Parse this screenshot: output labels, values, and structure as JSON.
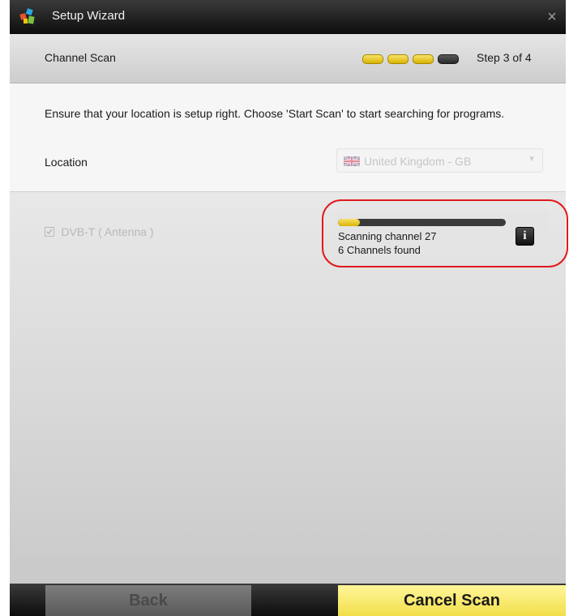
{
  "window": {
    "title": "Setup Wizard",
    "close_symbol": "×"
  },
  "header": {
    "title": "Channel Scan",
    "step_label": "Step 3 of 4",
    "steps_total": 4,
    "steps_completed": 3
  },
  "location": {
    "instructions": "Ensure that your location is setup right. Choose 'Start Scan' to start searching for programs.",
    "label": "Location",
    "selected_value": "United Kingdom - GB",
    "flag_icon": "uk-flag-icon"
  },
  "scan": {
    "source_label": "DVB-T ( Antenna )",
    "source_checked": true,
    "progress": 0.13,
    "status_line1": "Scanning channel 27",
    "status_line2": "6 Channels found",
    "info_icon_glyph": "i"
  },
  "footer": {
    "back_label": "Back",
    "cancel_label": "Cancel Scan"
  },
  "colors": {
    "accent_yellow": "#f2de4a",
    "highlight_red": "#e0191d",
    "titlebar_dark": "#0d0d0d"
  }
}
